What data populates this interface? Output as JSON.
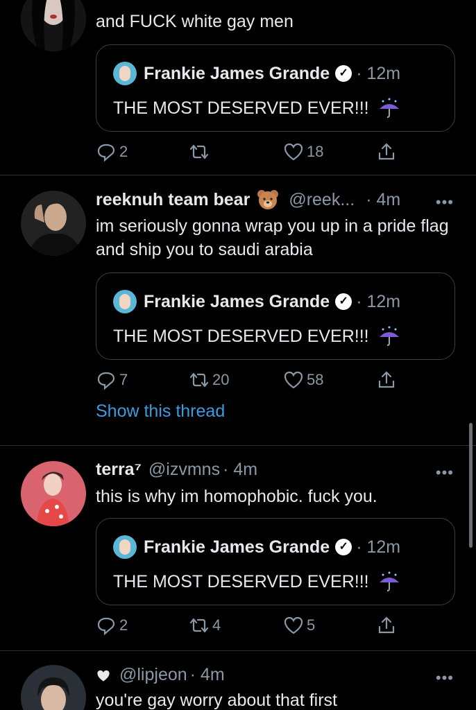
{
  "tweets": [
    {
      "text": "and FUCK white gay men",
      "quote": {
        "author": "Frankie James Grande",
        "time": "· 12m",
        "text": "THE MOST DESERVED EVER!!!"
      },
      "actions": {
        "reply": "2",
        "retweet": "",
        "like": "18"
      }
    },
    {
      "name": "reeknuh team bear",
      "name_emoji": "bear-face-icon",
      "handle": "@reek...",
      "time": "· 4m",
      "text": "im seriously gonna wrap you up in a pride flag and ship you to saudi arabia",
      "quote": {
        "author": "Frankie James Grande",
        "time": "· 12m",
        "text": "THE MOST DESERVED EVER!!!"
      },
      "actions": {
        "reply": "7",
        "retweet": "20",
        "like": "58"
      },
      "thread_link": "Show this thread"
    },
    {
      "name": "terra⁷",
      "handle": "@izvmns",
      "time": "· 4m",
      "text": "this is why im homophobic. fuck you.",
      "quote": {
        "author": "Frankie James Grande",
        "time": "· 12m",
        "text": "THE MOST DESERVED EVER!!!"
      },
      "actions": {
        "reply": "2",
        "retweet": "4",
        "like": "5"
      }
    },
    {
      "handle": "@lipjeon",
      "time": "· 4m",
      "text": "you're gay worry about that first"
    }
  ],
  "more_label": "•••",
  "colors": {
    "background": "#000000",
    "muted": "#8b98a5",
    "link": "#3b9be0",
    "divider": "#2f3336"
  }
}
